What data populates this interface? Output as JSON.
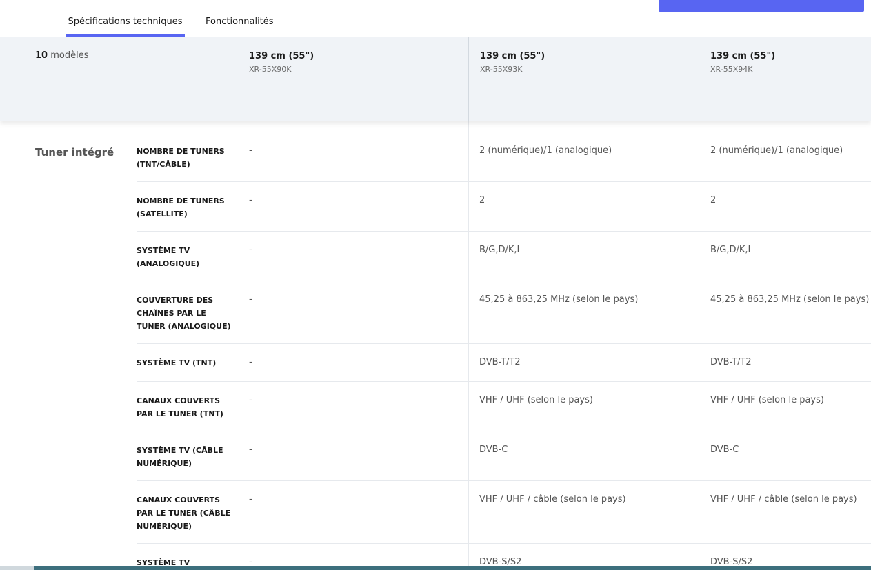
{
  "tabs": [
    {
      "label": "Spécifications techniques",
      "active": true
    },
    {
      "label": "Fonctionnalités",
      "active": false
    }
  ],
  "header": {
    "model_count_number": "10",
    "model_count_text": "modèles",
    "models": [
      {
        "size": "139 cm (55\")",
        "code": "XR-55X90K"
      },
      {
        "size": "139 cm (55\")",
        "code": "XR-55X93K"
      },
      {
        "size": "139 cm (55\")",
        "code": "XR-55X94K"
      }
    ]
  },
  "section": {
    "title": "Tuner intégré",
    "rows": [
      {
        "label": "NOMBRE DE TUNERS (TNT/CÂBLE)",
        "values": [
          "-",
          "2 (numérique)/1 (analogique)",
          "2 (numérique)/1 (analogique)"
        ]
      },
      {
        "label": "NOMBRE DE TUNERS (SATELLITE)",
        "values": [
          "-",
          "2",
          "2"
        ]
      },
      {
        "label": "SYSTÈME TV (ANALOGIQUE)",
        "values": [
          "-",
          "B/G,D/K,I",
          "B/G,D/K,I"
        ]
      },
      {
        "label": "COUVERTURE DES CHAÎNES PAR LE TUNER (ANALOGIQUE)",
        "values": [
          "-",
          "45,25 à 863,25 MHz (selon le pays)",
          "45,25 à 863,25 MHz (selon le pays)"
        ]
      },
      {
        "label": "SYSTÈME TV (TNT)",
        "values": [
          "-",
          "DVB-T/T2",
          "DVB-T/T2"
        ]
      },
      {
        "label": "CANAUX COUVERTS PAR LE TUNER (TNT)",
        "values": [
          "-",
          "VHF / UHF (selon le pays)",
          "VHF / UHF (selon le pays)"
        ]
      },
      {
        "label": "SYSTÈME TV (CÂBLE NUMÉRIQUE)",
        "values": [
          "-",
          "DVB-C",
          "DVB-C"
        ]
      },
      {
        "label": "CANAUX COUVERTS PAR LE TUNER (CÂBLE NUMÉRIQUE)",
        "values": [
          "-",
          "VHF / UHF / câble (selon le pays)",
          "VHF / UHF / câble (selon le pays)"
        ]
      },
      {
        "label": "SYSTÈME TV",
        "values": [
          "-",
          "DVB-S/S2",
          "DVB-S/S2"
        ]
      }
    ]
  },
  "colors": {
    "accent": "#5865f2",
    "header_bg": "#f0f3f7"
  }
}
